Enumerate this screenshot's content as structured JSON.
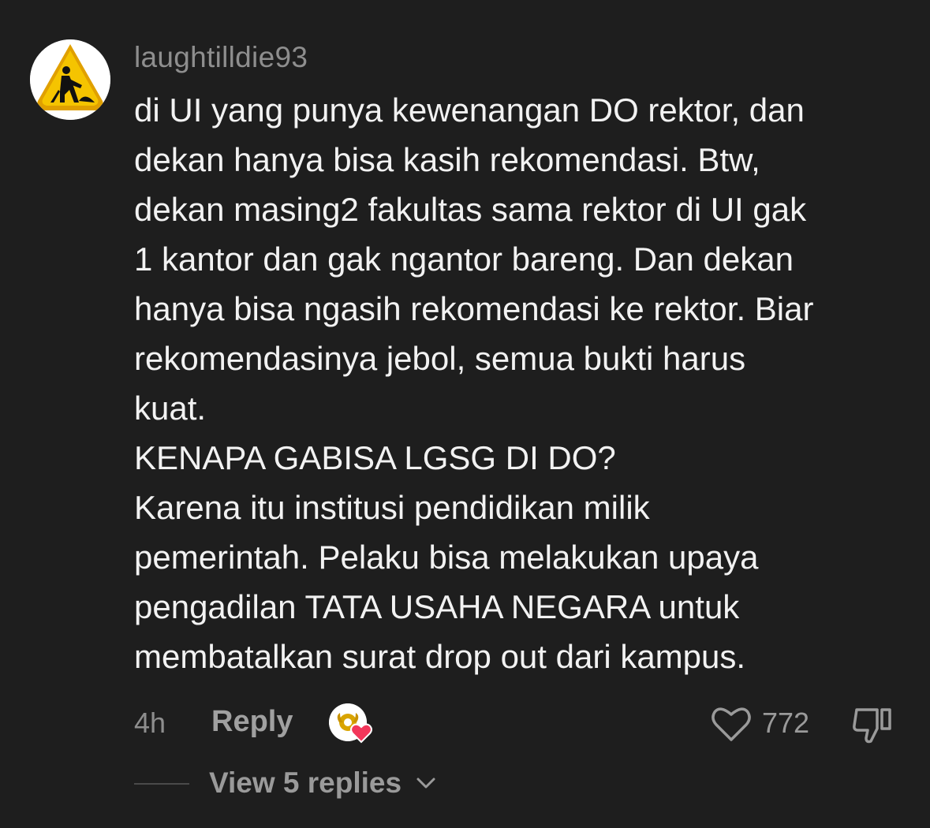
{
  "comment": {
    "username": "laughtilldie93",
    "avatar_icon": "construction-worker-icon",
    "body_lines": [
      "di UI yang punya kewenangan DO rektor, dan",
      "dekan hanya bisa kasih rekomendasi. Btw,",
      "dekan masing2 fakultas sama rektor di UI gak",
      "1 kantor dan gak ngantor bareng. Dan dekan",
      "hanya bisa ngasih rekomendasi ke rektor. Biar",
      "rekomendasinya jebol, semua bukti harus",
      "kuat.",
      "KENAPA GABISA LGSG DI DO?",
      "Karena itu institusi pendidikan milik",
      "pemerintah. Pelaku bisa melakukan upaya",
      "pengadilan TATA USAHA NEGARA untuk",
      "membatalkan surat drop out dari kampus."
    ]
  },
  "actions": {
    "timestamp": "4h",
    "reply_label": "Reply",
    "creator_liked_icon": "creator-heart-icon",
    "like_icon": "heart-outline-icon",
    "like_count": "772",
    "dislike_icon": "thumbs-down-icon"
  },
  "replies": {
    "view_label": "View 5 replies",
    "chevron_icon": "chevron-down-icon"
  },
  "colors": {
    "background": "#1e1e1e",
    "text_primary": "#f2f2f2",
    "text_secondary": "#8e8e8e",
    "heart_red": "#f2365a",
    "warning_yellow": "#f5c400"
  }
}
